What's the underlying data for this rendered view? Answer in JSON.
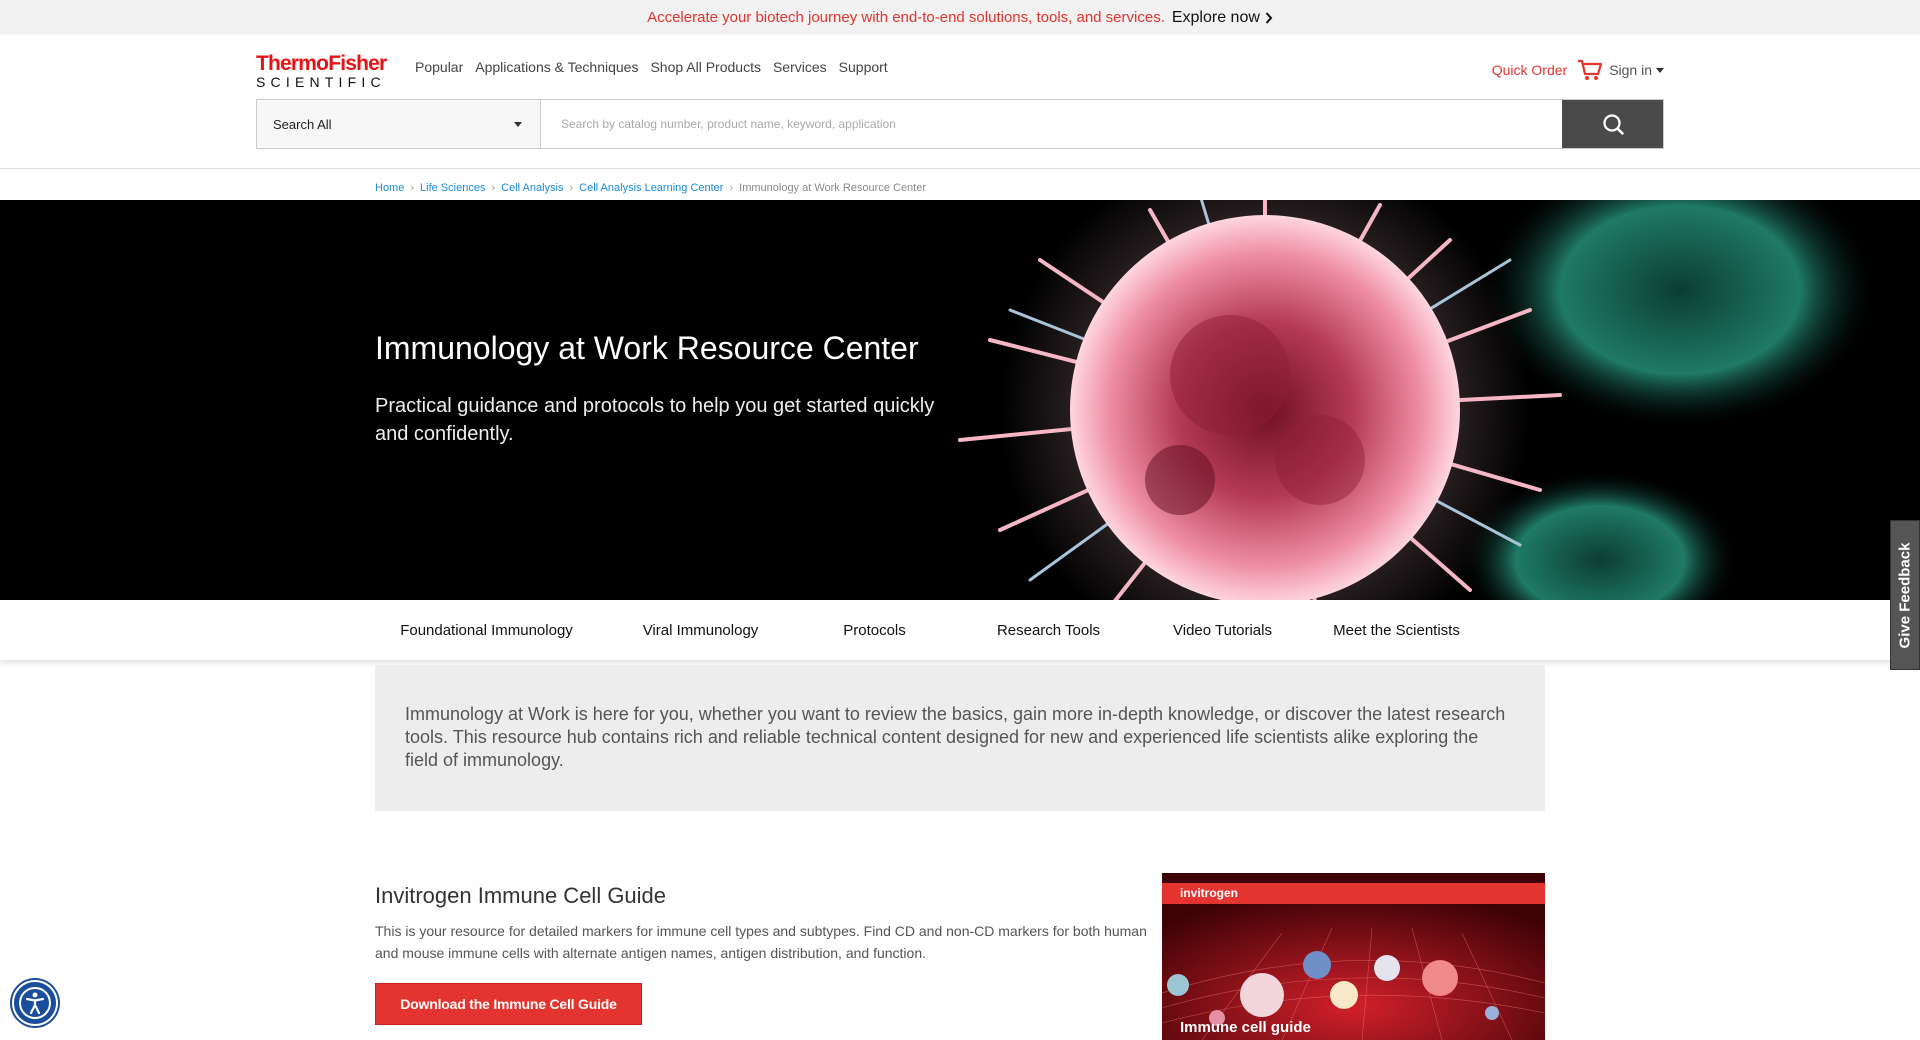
{
  "promo": {
    "message": "Accelerate your biotech journey with end-to-end solutions, tools, and services.",
    "cta": "Explore now"
  },
  "brand": {
    "line1": "ThermoFisher",
    "line2": "SCIENTIFIC",
    "accent": "#e3342f"
  },
  "nav": {
    "items": [
      "Popular",
      "Applications & Techniques",
      "Shop All Products",
      "Services",
      "Support"
    ]
  },
  "account": {
    "quick_order": "Quick Order",
    "sign_in": "Sign in"
  },
  "search": {
    "scope": "Search All",
    "placeholder": "Search by catalog number, product name, keyword, application"
  },
  "breadcrumb": {
    "items": [
      "Home",
      "Life Sciences",
      "Cell Analysis",
      "Cell Analysis Learning Center"
    ],
    "current": "Immunology at Work Resource Center"
  },
  "hero": {
    "title": "Immunology at Work Resource Center",
    "subtitle": "Practical guidance and protocols to help you get started quickly and confidently."
  },
  "tabs": [
    "Foundational Immunology",
    "Viral Immunology",
    "Protocols",
    "Research Tools",
    "Video Tutorials",
    "Meet the Scientists"
  ],
  "intro": {
    "text": "Immunology at Work is here for you, whether you want to review the basics, gain more in-depth knowledge, or discover the latest research tools. This resource hub contains rich and reliable technical content designed for new and experienced life scientists alike exploring the field of immunology."
  },
  "feature": {
    "title": "Invitrogen Immune Cell Guide",
    "description": "This is your resource for detailed markers for immune cell types and subtypes. Find CD and non-CD markers for both human and mouse immune cells with alternate antigen names, antigen distribution, and function.",
    "button": "Download the Immune Cell Guide",
    "image_brand": "invitrogen",
    "image_title": "Immune cell guide"
  },
  "feedback": {
    "label": "Give Feedback"
  },
  "icons": {
    "cart": "cart-icon",
    "search": "search-icon",
    "accessibility": "accessibility-icon"
  }
}
